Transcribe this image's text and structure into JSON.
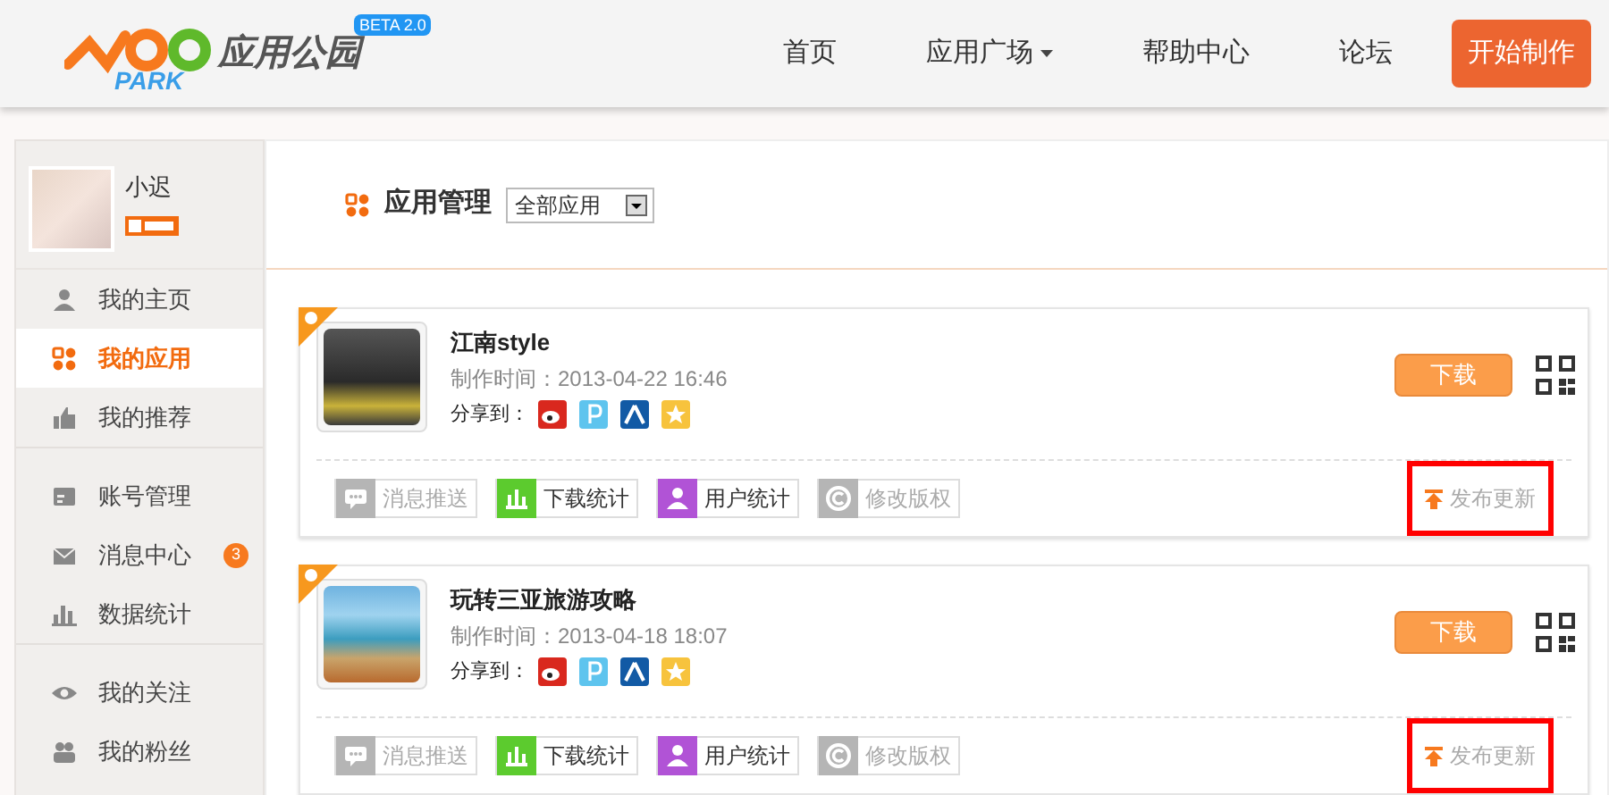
{
  "header": {
    "logo": {
      "name": "应用公园",
      "latin": "PARK",
      "badge": "BETA 2.0"
    },
    "nav": [
      {
        "label": "首页",
        "dropdown": false
      },
      {
        "label": "应用广场",
        "dropdown": true
      },
      {
        "label": "帮助中心",
        "dropdown": false
      },
      {
        "label": "论坛",
        "dropdown": false
      }
    ],
    "cta": "开始制作"
  },
  "sidebar": {
    "user": {
      "name": "小迟"
    },
    "groups": [
      [
        {
          "kind": "user",
          "label": "我的主页",
          "selected": false
        },
        {
          "kind": "apps",
          "label": "我的应用",
          "selected": true
        },
        {
          "kind": "thumb",
          "label": "我的推荐",
          "selected": false
        }
      ],
      [
        {
          "kind": "card",
          "label": "账号管理",
          "selected": false
        },
        {
          "kind": "mail",
          "label": "消息中心",
          "selected": false,
          "badge": "3"
        },
        {
          "kind": "chart",
          "label": "数据统计",
          "selected": false
        }
      ],
      [
        {
          "kind": "eye",
          "label": "我的关注",
          "selected": false
        },
        {
          "kind": "people",
          "label": "我的粉丝",
          "selected": false
        }
      ]
    ]
  },
  "main": {
    "title": "应用管理",
    "filter": "全部应用"
  },
  "apps": [
    {
      "title": "江南style",
      "time_label": "制作时间：",
      "time": "2013-04-22 16:46",
      "share_label": "分享到：",
      "shares": [
        {
          "kind": "weibo"
        },
        {
          "kind": "p"
        },
        {
          "kind": "renren"
        },
        {
          "kind": "star"
        }
      ],
      "download": "下载",
      "actions": [
        {
          "kind": "message",
          "label": "消息推送",
          "disabled": true
        },
        {
          "kind": "downloads",
          "label": "下载统计",
          "disabled": false
        },
        {
          "kind": "users",
          "label": "用户统计",
          "disabled": false
        },
        {
          "kind": "copyright",
          "label": "修改版权",
          "disabled": true
        }
      ],
      "publish": {
        "label": "发布更新",
        "highlighted": true
      }
    },
    {
      "title": "玩转三亚旅游攻略",
      "time_label": "制作时间：",
      "time": "2013-04-18 18:07",
      "share_label": "分享到：",
      "shares": [
        {
          "kind": "weibo"
        },
        {
          "kind": "p"
        },
        {
          "kind": "renren"
        },
        {
          "kind": "star"
        }
      ],
      "download": "下载",
      "actions": [
        {
          "kind": "message",
          "label": "消息推送",
          "disabled": true
        },
        {
          "kind": "downloads",
          "label": "下载统计",
          "disabled": false
        },
        {
          "kind": "users",
          "label": "用户统计",
          "disabled": false
        },
        {
          "kind": "copyright",
          "label": "修改版权",
          "disabled": true
        }
      ],
      "publish": {
        "label": "发布更新",
        "highlighted": true
      }
    }
  ]
}
